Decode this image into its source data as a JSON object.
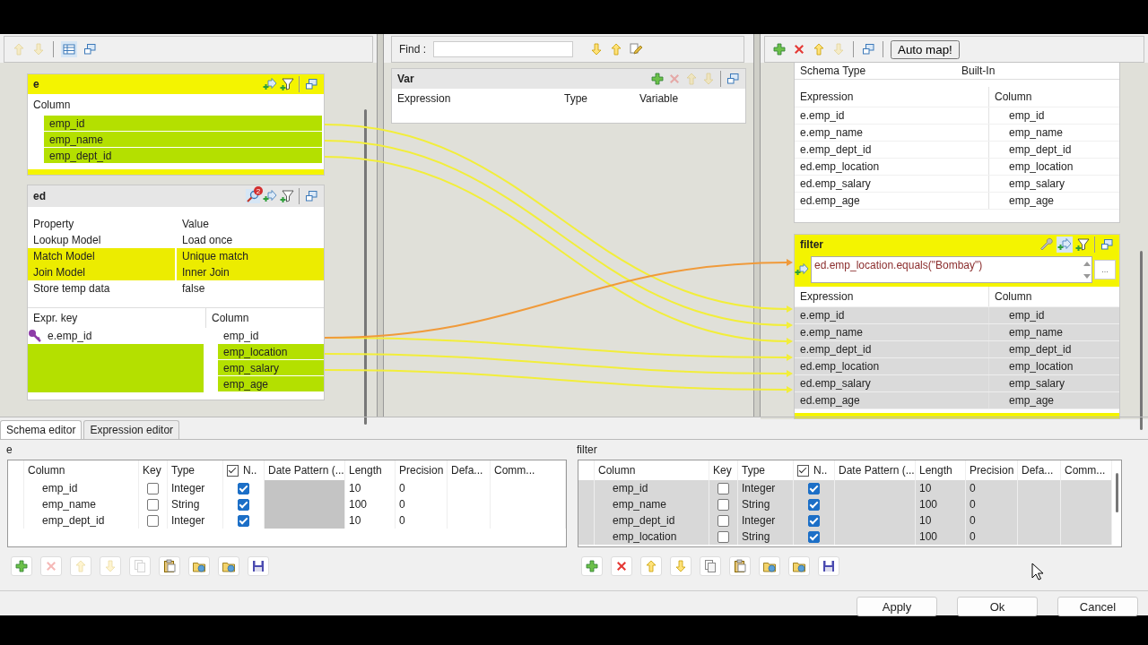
{
  "input_table": {
    "name": "e",
    "selected": true,
    "column_header": "Column",
    "columns": [
      {
        "name": "emp_id",
        "highlighted": true
      },
      {
        "name": "emp_name",
        "highlighted": true
      },
      {
        "name": "emp_dept_id",
        "highlighted": true
      }
    ]
  },
  "lookup_table": {
    "name": "ed",
    "selected": false,
    "badge": "2",
    "property_header": "Property",
    "value_header": "Value",
    "properties": [
      {
        "property": "Lookup Model",
        "value": "Load once",
        "highlighted": false
      },
      {
        "property": "Match Model",
        "value": "Unique match",
        "highlighted": true
      },
      {
        "property": "Join Model",
        "value": "Inner Join",
        "highlighted": true
      },
      {
        "property": "Store temp data",
        "value": "false",
        "highlighted": false
      }
    ],
    "key_header": "Expr. key",
    "column_header": "Column",
    "columns": [
      {
        "expr_key": "e.emp_id",
        "key": true,
        "name": "emp_id",
        "highlighted": false
      },
      {
        "key": false,
        "name": "emp_location",
        "highlighted": true
      },
      {
        "key": false,
        "name": "emp_salary",
        "highlighted": true
      },
      {
        "key": false,
        "name": "emp_age",
        "highlighted": true
      }
    ]
  },
  "search": {
    "label": "Find :"
  },
  "var_table": {
    "name": "Var",
    "columns": [
      "Expression",
      "Type",
      "Variable"
    ]
  },
  "output_toolbar": {
    "auto_map": "Auto map!"
  },
  "output_table": {
    "schema_label": "Schema Type",
    "schema_value": "Built-In",
    "expression_header": "Expression",
    "column_header": "Column",
    "rows": [
      {
        "expression": "e.emp_id",
        "column": "emp_id",
        "selected": false
      },
      {
        "expression": "e.emp_name",
        "column": "emp_name",
        "selected": false
      },
      {
        "expression": "e.emp_dept_id",
        "column": "emp_dept_id",
        "selected": false
      },
      {
        "expression": "ed.emp_location",
        "column": "emp_location",
        "selected": false
      },
      {
        "expression": "ed.emp_salary",
        "column": "emp_salary",
        "selected": false
      },
      {
        "expression": "ed.emp_age",
        "column": "emp_age",
        "selected": false
      }
    ]
  },
  "filter_table": {
    "name": "filter",
    "selected": true,
    "filter_expression": "ed.emp_location.equals(\"Bombay\")",
    "more": "...",
    "expression_header": "Expression",
    "column_header": "Column",
    "rows": [
      {
        "expression": "e.emp_id",
        "column": "emp_id",
        "selected": true
      },
      {
        "expression": "e.emp_name",
        "column": "emp_name",
        "selected": true
      },
      {
        "expression": "e.emp_dept_id",
        "column": "emp_dept_id",
        "selected": true
      },
      {
        "expression": "ed.emp_location",
        "column": "emp_location",
        "selected": true
      },
      {
        "expression": "ed.emp_salary",
        "column": "emp_salary",
        "selected": true
      },
      {
        "expression": "ed.emp_age",
        "column": "emp_age",
        "selected": true
      }
    ]
  },
  "editor_tabs": [
    {
      "label": "Schema editor",
      "selected": true
    },
    {
      "label": "Expression editor",
      "selected": false
    }
  ],
  "schema_editors": [
    {
      "title": "e",
      "all_nullable": true,
      "columns": [
        "Column",
        "Key",
        "Type",
        "N..",
        "Date Pattern (...",
        "Length",
        "Precision",
        "Defa...",
        "Comm..."
      ],
      "rows": [
        {
          "column": "emp_id",
          "key": false,
          "type": "Integer",
          "nullable": true,
          "length": "10",
          "precision": "0",
          "selected": false
        },
        {
          "column": "emp_name",
          "key": false,
          "type": "String",
          "nullable": true,
          "length": "100",
          "precision": "0",
          "selected": false
        },
        {
          "column": "emp_dept_id",
          "key": false,
          "type": "Integer",
          "nullable": true,
          "length": "10",
          "precision": "0",
          "selected": false
        }
      ],
      "toolbar": [
        {
          "disabled": false
        },
        {
          "disabled": true
        },
        {
          "disabled": true
        },
        {
          "disabled": true
        },
        {
          "disabled": true
        },
        {
          "disabled": false
        },
        {
          "disabled": false
        },
        {
          "disabled": false
        },
        {
          "disabled": false
        }
      ]
    },
    {
      "title": "filter",
      "all_nullable": true,
      "columns": [
        "Column",
        "Key",
        "Type",
        "N..",
        "Date Pattern (...",
        "Length",
        "Precision",
        "Defa...",
        "Comm..."
      ],
      "rows": [
        {
          "column": "emp_id",
          "key": false,
          "type": "Integer",
          "nullable": true,
          "length": "10",
          "precision": "0",
          "selected": true
        },
        {
          "column": "emp_name",
          "key": false,
          "type": "String",
          "nullable": true,
          "length": "100",
          "precision": "0",
          "selected": true
        },
        {
          "column": "emp_dept_id",
          "key": false,
          "type": "Integer",
          "nullable": true,
          "length": "10",
          "precision": "0",
          "selected": true
        },
        {
          "column": "emp_location",
          "key": false,
          "type": "String",
          "nullable": true,
          "length": "100",
          "precision": "0",
          "selected": true
        }
      ],
      "toolbar": [
        {
          "disabled": false
        },
        {
          "disabled": false
        },
        {
          "disabled": false
        },
        {
          "disabled": false
        },
        {
          "disabled": false
        },
        {
          "disabled": false
        },
        {
          "disabled": false
        },
        {
          "disabled": false
        },
        {
          "disabled": false
        }
      ]
    }
  ],
  "buttons": [
    "Apply",
    "Ok",
    "Cancel"
  ]
}
